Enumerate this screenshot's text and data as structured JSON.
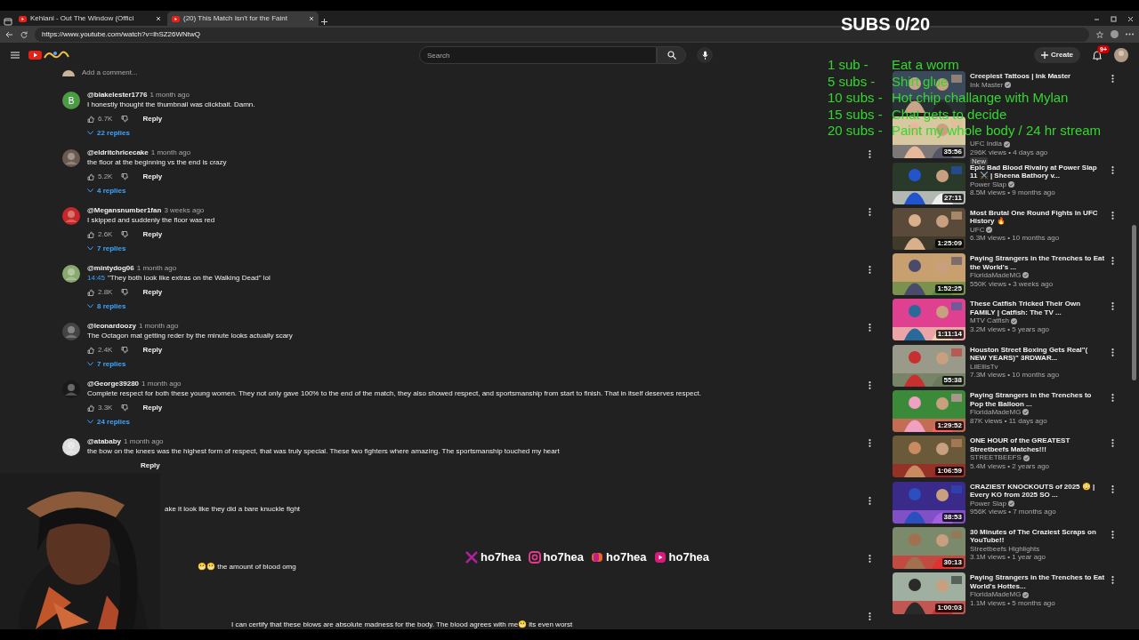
{
  "overlay": {
    "subs_counter": "SUBS 0/20",
    "goals": [
      {
        "tier": "1 sub -",
        "goal": "Eat a worm"
      },
      {
        "tier": "5 subs -",
        "goal": "Shirt glue"
      },
      {
        "tier": "10 subs -",
        "goal": "Hot chip challange with Mylan"
      },
      {
        "tier": "15 subs -",
        "goal": "Chat gets to decide"
      },
      {
        "tier": "20 subs -",
        "goal": "Paint my whole body / 24 hr stream"
      }
    ],
    "socials": [
      {
        "kind": "x",
        "handle": "ho7hea"
      },
      {
        "kind": "camera",
        "handle": "ho7hea"
      },
      {
        "kind": "bubble",
        "handle": "ho7hea"
      },
      {
        "kind": "play",
        "handle": "ho7hea"
      }
    ]
  },
  "browser": {
    "tabs": [
      {
        "title": "Kehlani - Out The Window (Offici",
        "selected": false
      },
      {
        "title": "(20) This Match Isn't for the Faint",
        "selected": true
      }
    ],
    "url": "https://www.youtube.com/watch?v=lhSZ26WNtwQ"
  },
  "header": {
    "search_placeholder": "Search",
    "create": "Create",
    "notifications": "9+"
  },
  "comments": {
    "add_comment_placeholder": "Add a comment...",
    "items": [
      {
        "kind": "full",
        "avatar_letter": "B",
        "user": "@blakelester1776",
        "time": "1 month ago",
        "text": "I honestly thought the thumbnail was clickbait. Damn.",
        "likes": "6.7K",
        "reply": "Reply",
        "replies": "22 replies",
        "menu": false
      },
      {
        "kind": "full",
        "user": "@eldritchricecake",
        "time": "1 month ago",
        "text": "the floor at the beginning vs the end is crazy",
        "likes": "5.2K",
        "reply": "Reply",
        "replies": "4 replies",
        "menu": true
      },
      {
        "kind": "full",
        "user": "@Megansnumber1fan",
        "time": "3 weeks ago",
        "text": "I skipped and suddenly the floor was red",
        "likes": "2.6K",
        "reply": "Reply",
        "replies": "7 replies",
        "menu": true
      },
      {
        "kind": "full",
        "user": "@mintydog06",
        "time": "1 month ago",
        "timestamp": "14:45",
        "text": "\"They both look like extras on the Walking Dead\" lol",
        "likes": "2.8K",
        "reply": "Reply",
        "replies": "8 replies",
        "menu": true
      },
      {
        "kind": "full",
        "user": "@leonardoozy",
        "time": "1 month ago",
        "text": "The Octagon mat getting reder by the minute looks actually scary",
        "likes": "2.4K",
        "reply": "Reply",
        "replies": "7 replies",
        "menu": true
      },
      {
        "kind": "full",
        "user": "@George39280",
        "time": "1 month ago",
        "text": "Complete respect for both these young women. They not only gave 100% to the end of the match, they also showed respect, and sportsmanship from start to finish. That in itself deserves respect.",
        "likes": "3.3K",
        "reply": "Reply",
        "replies": "24 replies",
        "menu": true
      },
      {
        "kind": "full",
        "user": "@atababy",
        "time": "1 month ago",
        "text": "the bow on the knees was the highest form of respect, that was truly special. These two fighters where amazing. The sportsmanship touched my heart",
        "reply": "Reply",
        "menu": true
      },
      {
        "kind": "partial",
        "text": "ake it look like they did a bare knuckle fight",
        "menu": true
      },
      {
        "kind": "partial",
        "text": "😬😬 the amount of blood omg",
        "menu": true
      },
      {
        "kind": "partial",
        "text": "I can certify that these blows are absolute madness for the body. The blood agrees with  me😬 its even worst",
        "menu": true
      }
    ]
  },
  "sidebar": {
    "videos": [
      {
        "title": "Creepiest Tattoos | Ink Master",
        "channel": "Ink Master",
        "verified": true,
        "menu": true
      },
      {
        "channel": "UFC India",
        "verified": true,
        "meta": "296K views • 4 days ago",
        "duration": "35:56",
        "badge": "New",
        "menu": false
      },
      {
        "title": "Epic Bad Blood Rivalry at Power Slap 11 ⚔️ | Sheena Bathory v...",
        "channel": "Power Slap",
        "verified": true,
        "meta": "8.5M views • 9 months ago",
        "duration": "27:11",
        "menu": true
      },
      {
        "title": "Most Brutal One Round Fights in UFC History 🔥",
        "channel": "UFC",
        "verified": true,
        "meta": "6.3M views • 10 months ago",
        "duration": "1:25:09",
        "menu": true
      },
      {
        "title": "Paying Strangers in the Trenches to Eat the World's ...",
        "channel": "FloridaMadeMG",
        "verified": true,
        "meta": "550K views • 3 weeks ago",
        "duration": "1:52:25",
        "menu": true
      },
      {
        "title": "These Catfish Tricked Their Own FAMILY | Catfish: The TV ...",
        "channel": "MTV Catfish",
        "verified": true,
        "meta": "3.2M views • 5 years ago",
        "duration": "1:11:14",
        "menu": true
      },
      {
        "title": "Houston Street Boxing Gets Real\"( NEW YEARS)\" 3RDWAR...",
        "channel": "LilEllisTv",
        "verified": false,
        "meta": "7.3M views • 10 months ago",
        "duration": "55:38",
        "menu": true
      },
      {
        "title": "Paying Strangers in the Trenches to Pop the Balloon ...",
        "channel": "FloridaMadeMG",
        "verified": true,
        "meta": "87K views • 11 days ago",
        "duration": "1:29:52",
        "menu": true
      },
      {
        "title": "ONE HOUR of the GREATEST Streetbeefs Matches!!!",
        "channel": "STREETBEEFS",
        "verified": true,
        "meta": "5.4M views • 2 years ago",
        "duration": "1:06:59",
        "menu": true
      },
      {
        "title": "CRAZIEST KNOCKOUTS of 2025 😳 | Every KO from 2025 SO ...",
        "channel": "Power Slap",
        "verified": true,
        "meta": "956K views • 7 months ago",
        "duration": "38:53",
        "menu": true
      },
      {
        "title": "30 Minutes of The Craziest Scraps on YouTube!!",
        "channel": "Streetbeefs Highlights",
        "verified": false,
        "meta": "3.1M views • 1 year ago",
        "duration": "30:13",
        "menu": true
      },
      {
        "title": "Paying Strangers in the Trenches to Eat World's Hottes...",
        "channel": "FloridaMadeMG",
        "verified": true,
        "meta": "1.1M views • 5 months ago",
        "duration": "1:00:03",
        "menu": true
      }
    ]
  }
}
